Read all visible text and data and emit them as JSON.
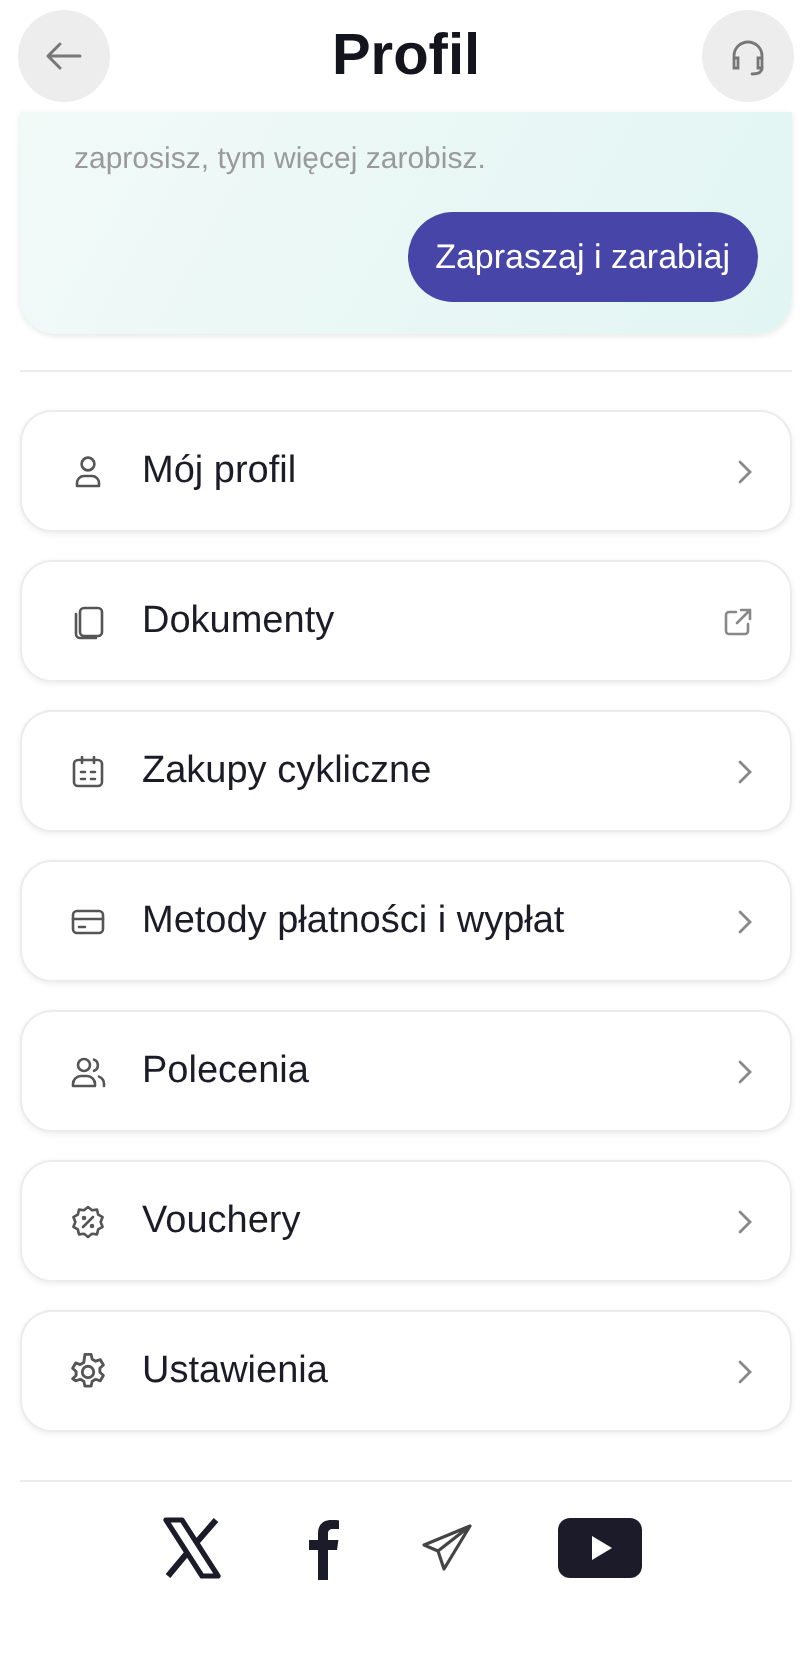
{
  "header": {
    "title": "Profil"
  },
  "referral_card": {
    "text": "zaprosisz, tym więcej zarobisz.",
    "button": "Zapraszaj i zarabiaj"
  },
  "menu": [
    {
      "label": "Mój profil",
      "kind": "chevron"
    },
    {
      "label": "Dokumenty",
      "kind": "external"
    },
    {
      "label": "Zakupy cykliczne",
      "kind": "chevron"
    },
    {
      "label": "Metody płatności i wypłat",
      "kind": "chevron"
    },
    {
      "label": "Polecenia",
      "kind": "chevron"
    },
    {
      "label": "Vouchery",
      "kind": "chevron"
    },
    {
      "label": "Ustawienia",
      "kind": "chevron"
    }
  ],
  "social": [
    {
      "kind": "x"
    },
    {
      "kind": "facebook"
    },
    {
      "kind": "telegram"
    },
    {
      "kind": "youtube"
    }
  ]
}
